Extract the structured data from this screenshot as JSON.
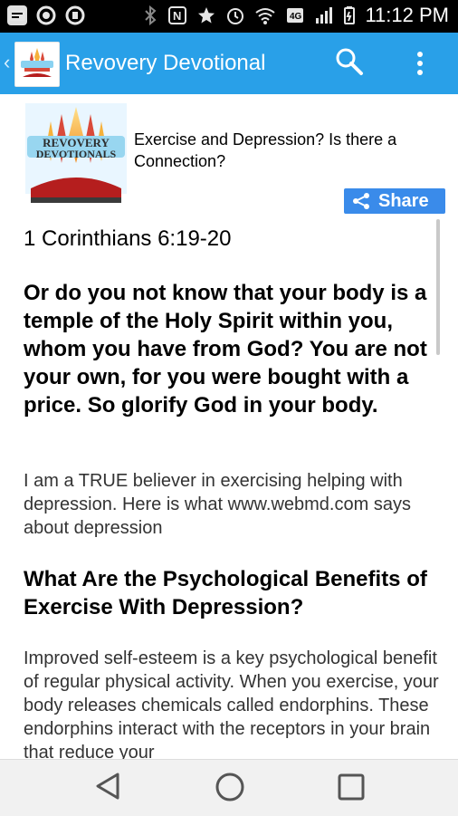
{
  "statusbar": {
    "time": "11:12 PM",
    "left_icons": [
      "notification-icon",
      "cast-icon",
      "cast2-icon",
      "bluetooth-icon",
      "nfc-icon",
      "star-icon",
      "alarm-icon",
      "wifi-icon",
      "data-icon",
      "signal-icon",
      "battery-icon"
    ]
  },
  "actionbar": {
    "title": "Revovery Devotional",
    "icons": [
      "back-chevron-icon",
      "app-logo",
      "search-icon",
      "overflow-icon"
    ],
    "color": "#29a0e8"
  },
  "content": {
    "devotional_title": "Exercise and Depression? Is there a Connection?",
    "share_label": "Share",
    "reference": "1 Corinthians 6:19-20",
    "verse": "Or do you not know that your body is a temple of the Holy Spirit within you, whom you have from God? You are not your own, for you were bought with a price. So glorify God in your body.",
    "paragraph1": "I am a TRUE believer in exercising helping with depression. Here is what www.webmd.com says about depression",
    "subheading": "What Are the Psychological Benefits of Exercise With Depression?",
    "paragraph2": "Improved self-esteem is a key psychological benefit of regular physical activity. When you exercise, your body releases chemicals called endorphins. These endorphins interact with the receptors in your brain that reduce your"
  },
  "logo_text": {
    "line1": "REVOVERY",
    "line2": "DEVOTIONALS"
  },
  "navbar": {
    "icons": [
      "nav-back-icon",
      "nav-home-icon",
      "nav-recent-icon"
    ]
  }
}
